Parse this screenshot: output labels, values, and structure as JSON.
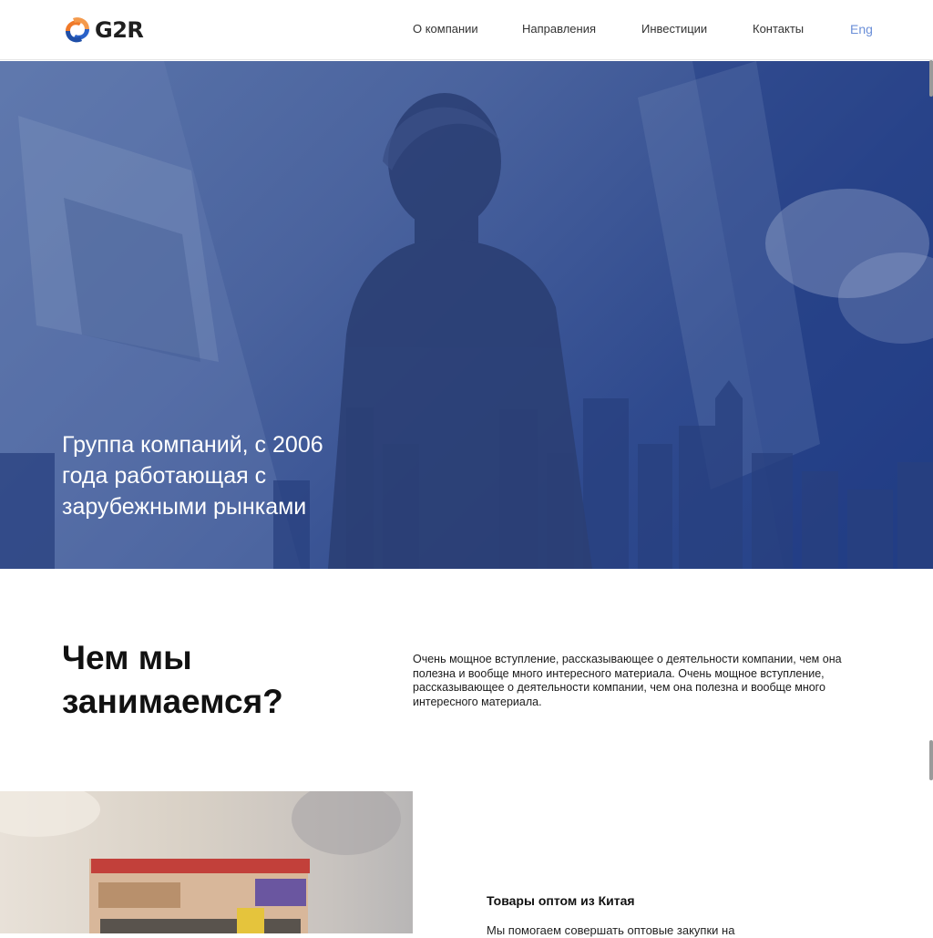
{
  "header": {
    "logo_text": "G2R",
    "nav": [
      {
        "label": "О компании"
      },
      {
        "label": "Направления"
      },
      {
        "label": "Инвестиции"
      },
      {
        "label": "Контакты"
      }
    ],
    "language_label": "Eng"
  },
  "hero": {
    "title": "Группа компаний, с 2006 года работающая с зарубежными рынками"
  },
  "about": {
    "title": "Чем мы занимаемся?",
    "description": "Очень мощное вступление, рассказывающее о деятельности компании, чем она полезна и вообще много интересного материала. Очень мощное вступление, рассказывающее о деятельности компании, чем она полезна и вообще много интересного материала."
  },
  "product": {
    "title": "Товары оптом из Китая",
    "description": "Мы помогаем совершать оптовые закупки на"
  },
  "colors": {
    "brand_orange": "#f07a2a",
    "brand_blue": "#2a62c9",
    "hero_overlay": "#2a4a8f",
    "lang_link": "#6b8fd8"
  },
  "icons": {
    "logo": "g2r-logo-icon"
  }
}
